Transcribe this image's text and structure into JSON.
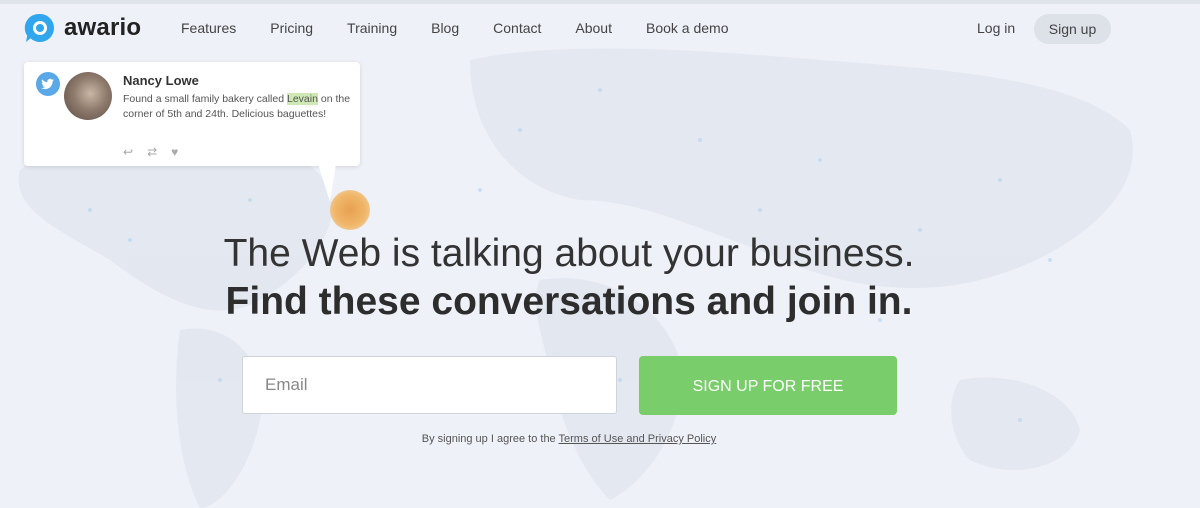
{
  "brand": {
    "name": "awario",
    "accent": "#2fa6ee"
  },
  "nav": {
    "items": [
      {
        "label": "Features"
      },
      {
        "label": "Pricing"
      },
      {
        "label": "Training"
      },
      {
        "label": "Blog"
      },
      {
        "label": "Contact"
      },
      {
        "label": "About"
      },
      {
        "label": "Book a demo"
      }
    ]
  },
  "auth": {
    "login_label": "Log in",
    "signup_label": "Sign up"
  },
  "mention_card": {
    "source_icon": "twitter-icon",
    "author": "Nancy Lowe",
    "text_before": "Found a small family bakery called ",
    "highlight": "Levain",
    "text_after": " on the corner of 5th and 24th. Delicious baguettes!",
    "actions": [
      {
        "icon": "reply-icon",
        "glyph": "↩"
      },
      {
        "icon": "retweet-icon",
        "glyph": "⇄"
      },
      {
        "icon": "heart-icon",
        "glyph": "♥"
      }
    ]
  },
  "hero": {
    "headline": "The Web is talking about your business.",
    "subheadline": "Find these conversations and join in."
  },
  "signup_form": {
    "email_placeholder": "Email",
    "email_value": "",
    "cta_label": "SIGN UP FOR FREE",
    "cta_color": "#79cd6a",
    "terms_prefix": "By signing up I agree to the ",
    "terms_link": "Terms of Use and Privacy Policy"
  }
}
